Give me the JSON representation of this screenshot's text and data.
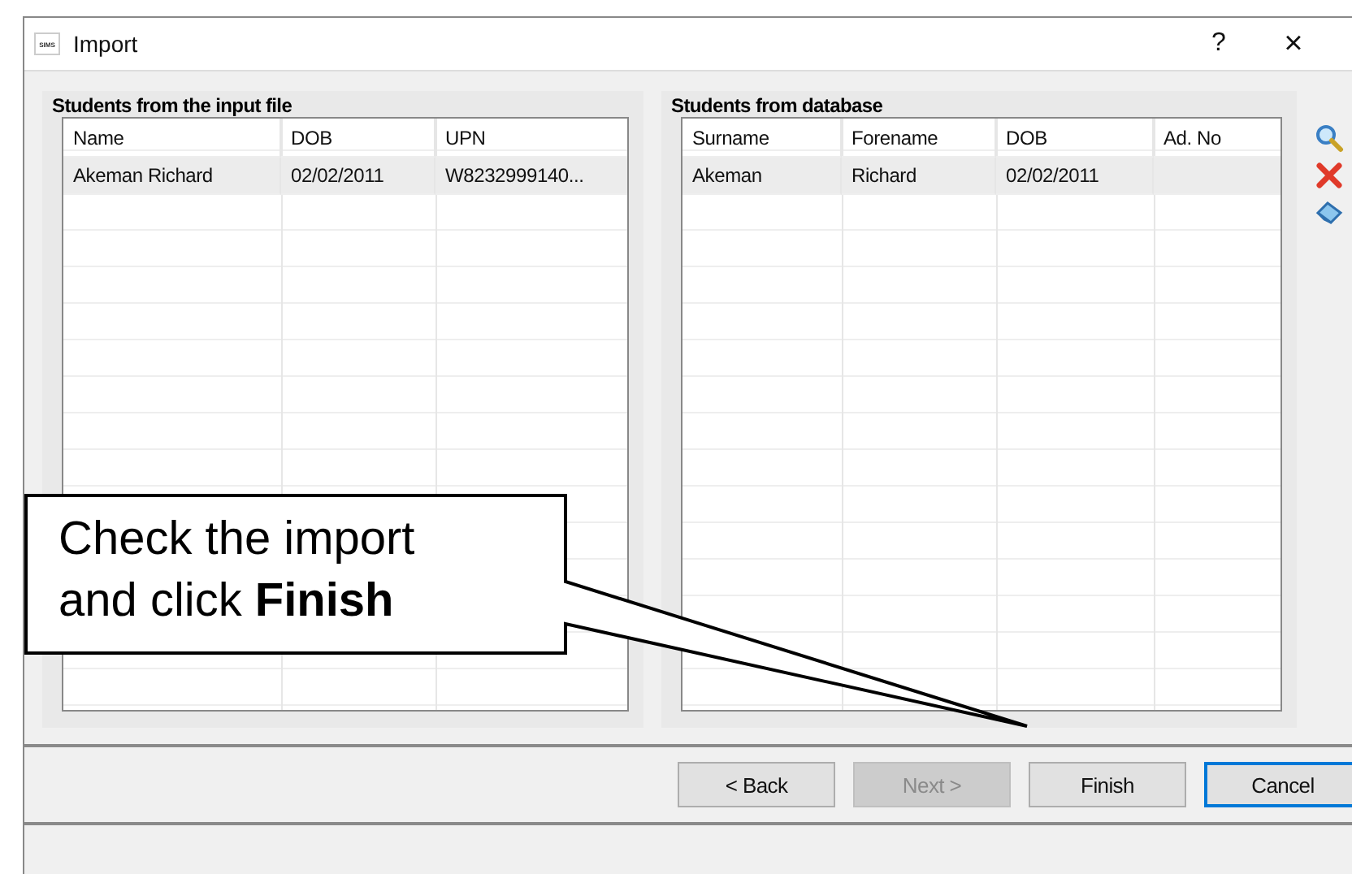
{
  "window": {
    "app_icon_text": "SIMS",
    "title": "Import",
    "help": "?",
    "close": "×"
  },
  "input_panel": {
    "title": "Students from the input file",
    "columns": [
      "Name",
      "DOB",
      "UPN"
    ],
    "rows": [
      {
        "cells": [
          "Akeman Richard",
          "02/02/2011",
          "W8232999140..."
        ],
        "selected": true
      }
    ]
  },
  "database_panel": {
    "title": "Students from database",
    "columns": [
      "Surname",
      "Forename",
      "DOB",
      "Ad. No"
    ],
    "rows": [
      {
        "cells": [
          "Akeman",
          "Richard",
          "02/02/2011",
          ""
        ],
        "selected": true
      }
    ]
  },
  "buttons": [
    {
      "label": "< Back",
      "disabled": false,
      "focused": false
    },
    {
      "label": "Next >",
      "disabled": true,
      "focused": false
    },
    {
      "label": "Finish",
      "disabled": false,
      "focused": false
    },
    {
      "label": "Cancel",
      "disabled": false,
      "focused": true
    }
  ],
  "callout": {
    "text": "Check the import\nand click **Finish**"
  }
}
